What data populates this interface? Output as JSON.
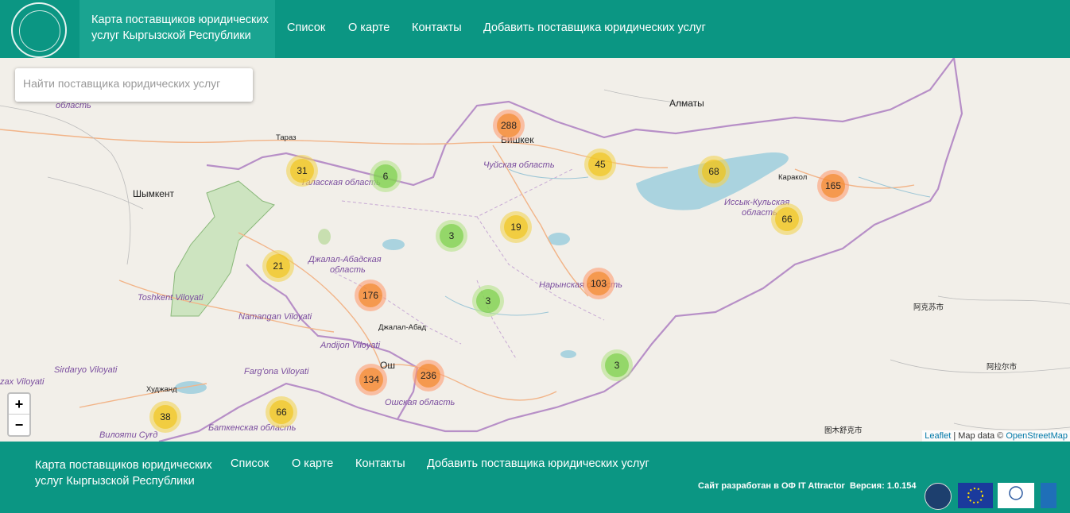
{
  "header": {
    "brand_line1": "Карта поставщиков юридических",
    "brand_line2": "услуг Кыргызской Республики",
    "nav": [
      "Список",
      "О карте",
      "Контакты",
      "Добавить поставщика юридических услуг"
    ]
  },
  "search": {
    "placeholder": "Найти поставщика юридических услуг"
  },
  "zoom": {
    "in": "+",
    "out": "−"
  },
  "clusters": [
    "288",
    "31",
    "6",
    "45",
    "68",
    "165",
    "66",
    "3",
    "19",
    "21",
    "176",
    "103",
    "3",
    "3",
    "134",
    "236",
    "38",
    "66"
  ],
  "labels": {
    "oblast_top": "область",
    "almaty": "Алматы",
    "taraz": "Тараз",
    "bishkek": "Бишкек",
    "chuy": "Чуйская область",
    "talas": "Таласская область",
    "shymkent": "Шымкент",
    "karakol": "Каракол",
    "issyk1": "Иссык-Кульская",
    "issyk2": "область",
    "jalal1": "Джалал-Абадская",
    "jalal2": "область",
    "naryn": "Нарынская область",
    "toshkent": "Toshkent Viloyati",
    "namangan": "Namangan Viloyati",
    "jalalcity": "Джалал-Абад",
    "andijon": "Andijon Viloyati",
    "sirdaryo": "Sirdaryo Viloyati",
    "fargona": "Farg'ona Viloyati",
    "osh": "Ош",
    "jizzax": "zax Viloyati",
    "khujand": "Худжанд",
    "osh_oblast": "Ошская область",
    "sughd": "Вилояти Суғд",
    "batken": "Баткенская область",
    "aksu": "阿克苏市",
    "alar": "阿拉尔市",
    "tumshuk": "图木舒克市"
  },
  "attribution": {
    "leaflet": "Leaflet",
    "data": " | Map data © ",
    "osm": "OpenStreetMap"
  },
  "footer": {
    "brand_line1": "Карта поставщиков юридических",
    "brand_line2": "услуг Кыргызской Республики",
    "nav": [
      "Список",
      "О карте",
      "Контакты",
      "Добавить поставщика юридических услуг"
    ],
    "developer": "Сайт разработан в ОФ IT Attractor",
    "version": "Версия: 1.0.154"
  },
  "colors": {
    "primary": "#0b9683",
    "brand_bg": "#1aa491"
  }
}
